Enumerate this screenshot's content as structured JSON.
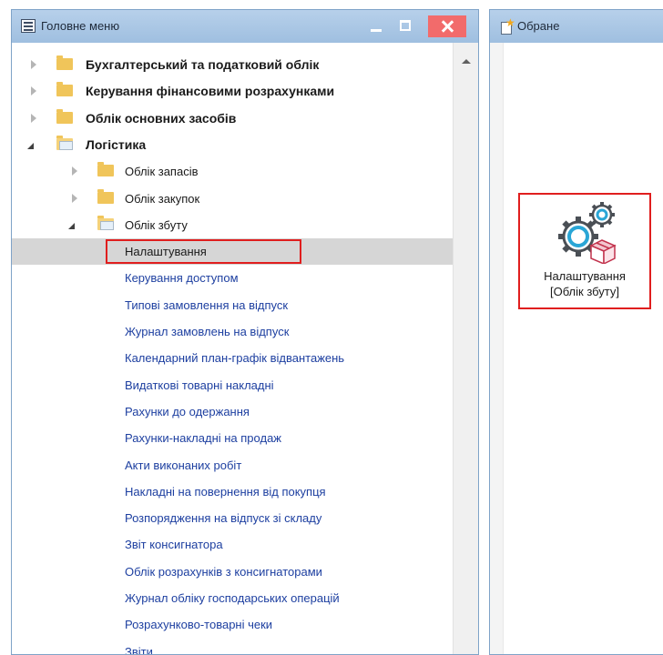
{
  "main_window": {
    "title": "Головне меню",
    "tree": [
      {
        "label": "Бухгалтерський та податковий облік",
        "level": 0,
        "type": "folder",
        "expanded": false,
        "bold": true
      },
      {
        "label": "Керування фінансовими розрахунками",
        "level": 0,
        "type": "folder",
        "expanded": false,
        "bold": true
      },
      {
        "label": "Облік основних засобів",
        "level": 0,
        "type": "folder",
        "expanded": false,
        "bold": true
      },
      {
        "label": "Логістика",
        "level": 0,
        "type": "folder",
        "expanded": true,
        "bold": true
      },
      {
        "label": "Облік запасів",
        "level": 1,
        "type": "folder",
        "expanded": false
      },
      {
        "label": "Облік закупок",
        "level": 1,
        "type": "folder",
        "expanded": false
      },
      {
        "label": "Облік збуту",
        "level": 1,
        "type": "folder",
        "expanded": true
      },
      {
        "label": "Налаштування",
        "level": 2,
        "type": "item",
        "selected": true,
        "highlighted": true
      },
      {
        "label": "Керування доступом",
        "level": 2,
        "type": "item"
      },
      {
        "label": "Типові замовлення на відпуск",
        "level": 2,
        "type": "item"
      },
      {
        "label": "Журнал замовлень на відпуск",
        "level": 2,
        "type": "item"
      },
      {
        "label": "Календарний план-графік відвантажень",
        "level": 2,
        "type": "item"
      },
      {
        "label": "Видаткові товарні накладні",
        "level": 2,
        "type": "item"
      },
      {
        "label": "Рахунки до одержання",
        "level": 2,
        "type": "item"
      },
      {
        "label": "Рахунки-накладні на продаж",
        "level": 2,
        "type": "item"
      },
      {
        "label": "Акти виконаних робіт",
        "level": 2,
        "type": "item"
      },
      {
        "label": "Накладні на повернення від покупця",
        "level": 2,
        "type": "item"
      },
      {
        "label": "Розпорядження на відпуск зі складу",
        "level": 2,
        "type": "item"
      },
      {
        "label": "Звіт консигнатора",
        "level": 2,
        "type": "item"
      },
      {
        "label": "Облік розрахунків з консигнаторами",
        "level": 2,
        "type": "item"
      },
      {
        "label": "Журнал обліку господарських операцій",
        "level": 2,
        "type": "item"
      },
      {
        "label": "Розрахунково-товарні чеки",
        "level": 2,
        "type": "item"
      },
      {
        "label": "Звіти",
        "level": 2,
        "type": "item"
      }
    ]
  },
  "favorites_window": {
    "title": "Обране",
    "shortcut": {
      "line1": "Налаштування",
      "line2": "[Облік збуту]",
      "icon": "gears-box-icon"
    }
  },
  "colors": {
    "titlebar": "#a9c7e6",
    "close_button": "#f26b6b",
    "link_text": "#1d3fa0",
    "selection": "#d6d6d6",
    "highlight_border": "#e01e1e",
    "folder": "#f0c55a"
  }
}
